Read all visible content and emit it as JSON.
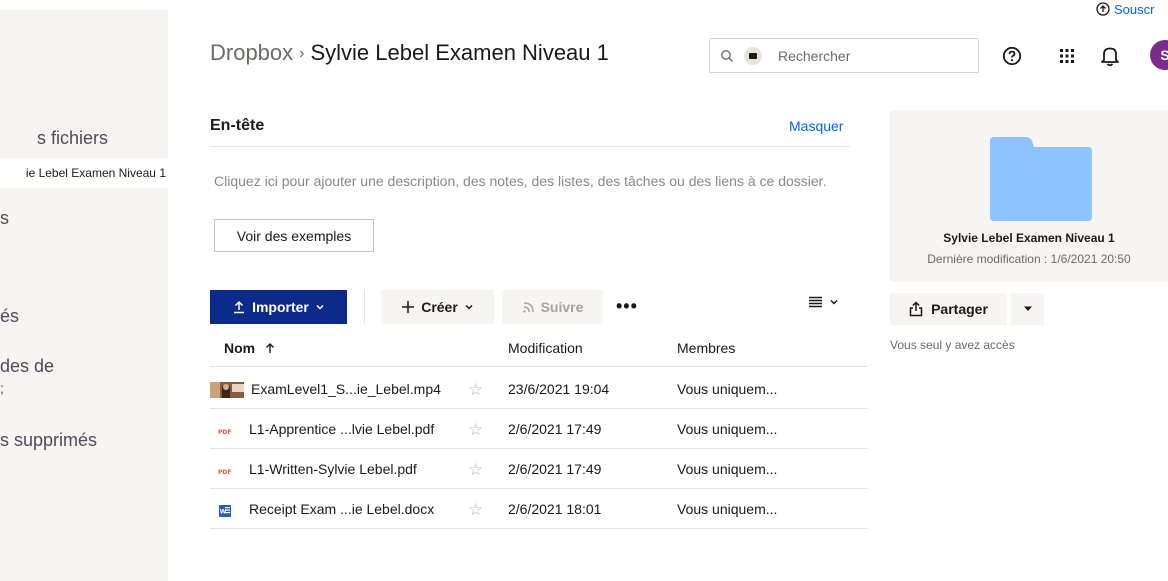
{
  "topbar": {
    "subscribe_label": "Souscr"
  },
  "sidebar": {
    "items": [
      {
        "label": "s fichiers"
      },
      {
        "label": "ie Lebel Examen Niveau 1"
      },
      {
        "label": "s"
      },
      {
        "label": "és"
      },
      {
        "label": "des de"
      },
      {
        "label": ";"
      },
      {
        "label": "s supprimés"
      }
    ]
  },
  "header": {
    "breadcrumb_root": "Dropbox",
    "breadcrumb_sep": "›",
    "breadcrumb_current": "Sylvie Lebel Examen Niveau 1",
    "search_placeholder": "Rechercher",
    "avatar_initial": "S"
  },
  "banner": {
    "title": "En-tête",
    "hide_label": "Masquer",
    "description": "Cliquez ici pour ajouter une description, des notes, des listes, des tâches ou des liens à ce dossier.",
    "examples_label": "Voir des exemples"
  },
  "toolbar": {
    "import_label": "Importer",
    "create_label": "Créer",
    "follow_label": "Suivre",
    "more_label": "•••"
  },
  "table": {
    "col_name": "Nom",
    "col_modified": "Modification",
    "col_members": "Membres",
    "rows": [
      {
        "name": "ExamLevel1_S...ie_Lebel.mp4",
        "modified": "23/6/2021 19:04",
        "members": "Vous uniquem...",
        "type": "video"
      },
      {
        "name": "L1-Apprentice ...lvie Lebel.pdf",
        "modified": "2/6/2021 17:49",
        "members": "Vous uniquem...",
        "type": "pdf"
      },
      {
        "name": "L1-Written-Sylvie Lebel.pdf",
        "modified": "2/6/2021 17:49",
        "members": "Vous uniquem...",
        "type": "pdf"
      },
      {
        "name": "Receipt Exam ...ie Lebel.docx",
        "modified": "2/6/2021 18:01",
        "members": "Vous uniquem...",
        "type": "word"
      }
    ]
  },
  "details": {
    "folder_name": "Sylvie Lebel Examen Niveau 1",
    "last_modified": "Dernière modification : 1/6/2021 20:50",
    "share_label": "Partager",
    "access_text": "Vous seul y avez accès"
  },
  "colors": {
    "accent": "#0b2a8a",
    "link": "#0061fe",
    "folder": "#8ec3ff",
    "avatar": "#7b2c8a"
  }
}
